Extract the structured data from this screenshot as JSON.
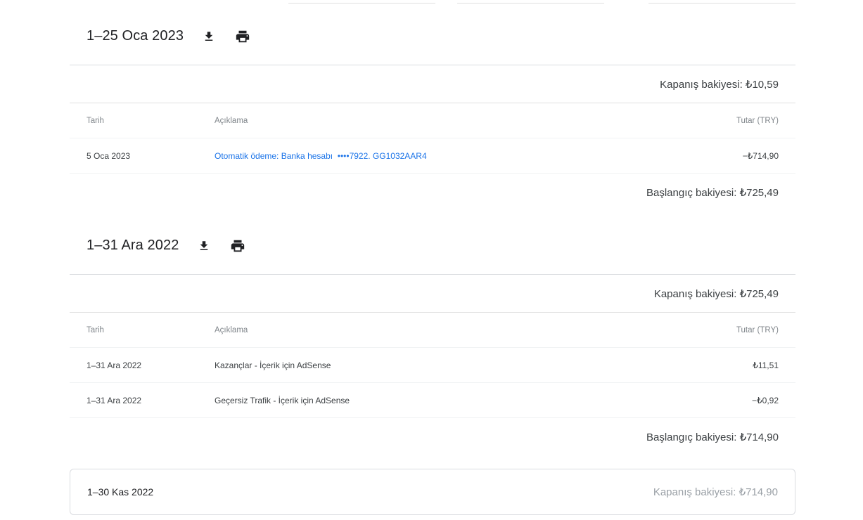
{
  "statements": [
    {
      "title": "1–25 Oca 2023",
      "closing": "Kapanış bakiyesi: ₺10,59",
      "opening": "Başlangıç bakiyesi: ₺725,49",
      "headers": {
        "date": "Tarih",
        "desc": "Açıklama",
        "amount": "Tutar (TRY)"
      },
      "rows": [
        {
          "date": "5 Oca 2023",
          "desc": "Otomatik ödeme: Banka hesabı  ••••7922. GG1032AAR4",
          "amount": "−₺714,90"
        }
      ]
    },
    {
      "title": "1–31 Ara 2022",
      "closing": "Kapanış bakiyesi: ₺725,49",
      "opening": "Başlangıç bakiyesi: ₺714,90",
      "headers": {
        "date": "Tarih",
        "desc": "Açıklama",
        "amount": "Tutar (TRY)"
      },
      "rows": [
        {
          "date": "1–31 Ara 2022",
          "desc": "Kazançlar - İçerik için AdSense",
          "amount": "₺11,51"
        },
        {
          "date": "1–31 Ara 2022",
          "desc": "Geçersiz Trafik - İçerik için AdSense",
          "amount": "−₺0,92"
        }
      ]
    }
  ],
  "collapsed": {
    "title": "1–30 Kas 2022",
    "closing": "Kapanış bakiyesi: ₺714,90"
  },
  "icons": {
    "download": "download-icon",
    "print": "print-icon"
  },
  "colors": {
    "link": "#1a73e8",
    "text": "#202124",
    "muted": "#80868b",
    "divider": "#dadce0"
  }
}
